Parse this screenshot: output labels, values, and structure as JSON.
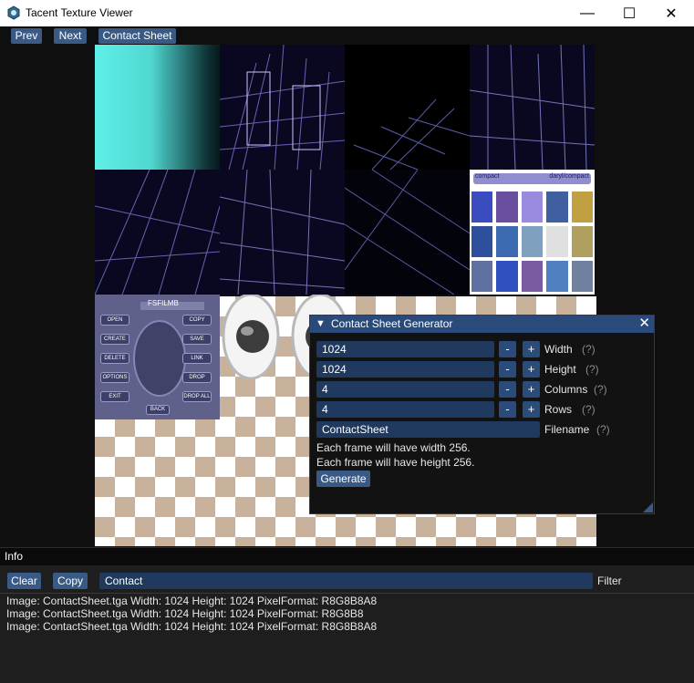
{
  "window": {
    "title": "Tacent Texture Viewer",
    "minimize_glyph": "—",
    "maximize_glyph": "☐",
    "close_glyph": "✕"
  },
  "toolbar": {
    "prev_label": "Prev",
    "next_label": "Next",
    "contact_sheet_label": "Contact Sheet"
  },
  "atlas_text": {
    "top_left": "compact",
    "top_right": "daryl/compact",
    "menu_header": "FSFILMB",
    "menu_buttons": [
      "OPEN",
      "COPY",
      "CREATE",
      "SAVE",
      "DELETE",
      "LINK",
      "OPTIONS",
      "DROP",
      "EXIT",
      "DROP ALL"
    ],
    "menu_back": "BACK"
  },
  "contact_sheet": {
    "title": "Contact Sheet Generator",
    "fields": [
      {
        "value": "1024",
        "label": "Width",
        "help": "(?)"
      },
      {
        "value": "1024",
        "label": "Height",
        "help": "(?)"
      },
      {
        "value": "4",
        "label": "Columns",
        "help": "(?)"
      },
      {
        "value": "4",
        "label": "Rows",
        "help": "(?)"
      }
    ],
    "minus": "-",
    "plus": "+",
    "filename_value": "ContactSheet",
    "filename_label": "Filename",
    "filename_help": "(?)",
    "msg_width": "Each frame will have width 256.",
    "msg_height": "Each frame will have height 256.",
    "generate_label": "Generate"
  },
  "info": {
    "title": "Info",
    "clear_label": "Clear",
    "copy_label": "Copy",
    "filter_value": "Contact",
    "filter_label": "Filter",
    "log": [
      "Image: ContactSheet.tga Width: 1024 Height: 1024 PixelFormat: R8G8B8A8",
      "Image: ContactSheet.tga Width: 1024 Height: 1024 PixelFormat: R8G8B8",
      "Image: ContactSheet.tga Width: 1024 Height: 1024 PixelFormat: R8G8B8A8"
    ]
  },
  "colors": {
    "accent": "#3a5a86",
    "dialog_title": "#294a7a",
    "input_bg": "#1f3a5e",
    "checker": "#c8b29c",
    "cyan_tile": "#5ef0e8"
  }
}
